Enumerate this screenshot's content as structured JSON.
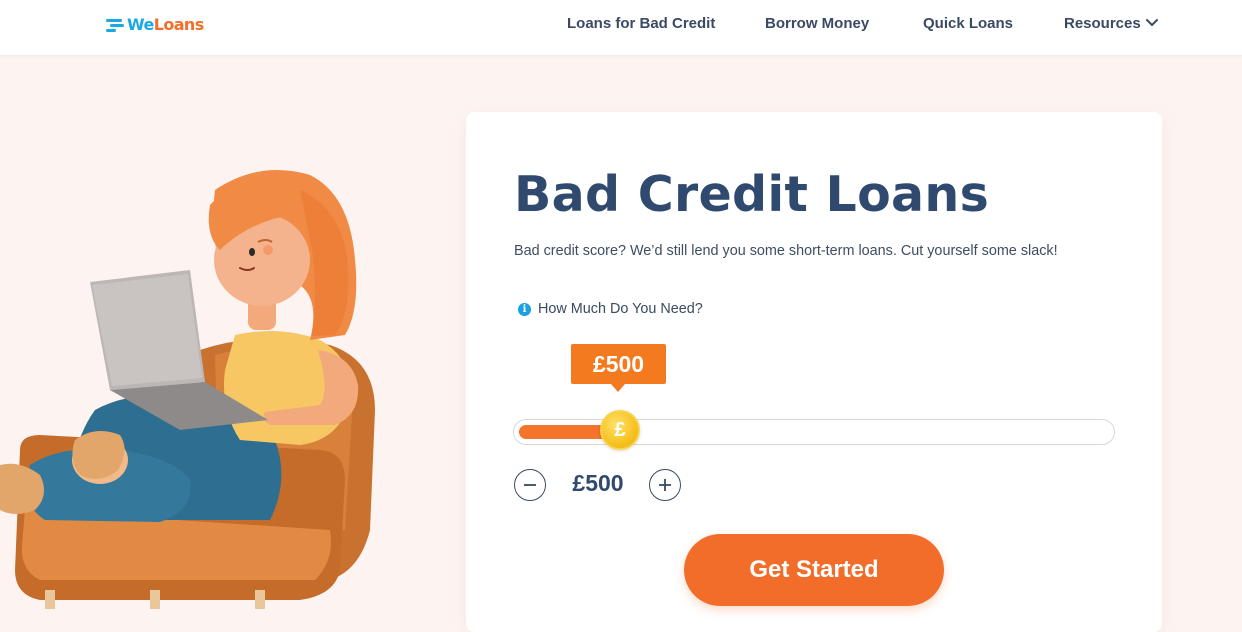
{
  "brand": {
    "logo_we": "We",
    "logo_loans": "Loans",
    "primary_color": "#f26d2a",
    "secondary_color": "#1aa9e4",
    "heading_color": "#2f4a6e"
  },
  "nav": {
    "items": [
      {
        "label": "Loans for Bad Credit"
      },
      {
        "label": "Borrow Money"
      },
      {
        "label": "Quick Loans"
      },
      {
        "label": "Resources",
        "icon": "chevron-down-icon"
      }
    ]
  },
  "hero": {
    "title": "Bad Credit Loans",
    "subtitle": "Bad credit score? We’d still lend you some short-term loans. Cut yourself some slack!",
    "question": "How Much Do You Need?",
    "info_icon": "info-icon",
    "tooltip_value": "£500",
    "slider": {
      "thumb_symbol": "£",
      "fraction": 0.175
    },
    "amount": "£500",
    "cta_label": "Get Started"
  }
}
